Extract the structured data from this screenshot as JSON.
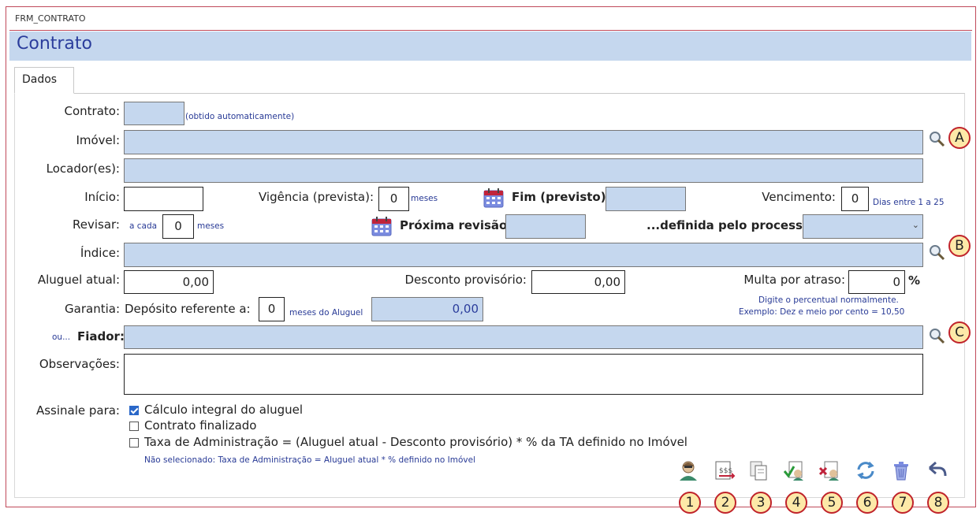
{
  "window": {
    "form_name": "FRM_CONTRATO",
    "title": "Contrato"
  },
  "tabs": [
    {
      "label": "Dados"
    }
  ],
  "fields": {
    "contrato": {
      "label": "Contrato:",
      "value": "",
      "note": "(obtido automaticamente)"
    },
    "imovel": {
      "label": "Imóvel:",
      "value": ""
    },
    "locador": {
      "label": "Locador(es):",
      "value": ""
    },
    "inicio": {
      "label": "Início:",
      "value": ""
    },
    "vigencia": {
      "label": "Vigência (prevista):",
      "value": "0",
      "unit": "meses"
    },
    "fim": {
      "label": "Fim (previsto):",
      "value": ""
    },
    "vencimento": {
      "label": "Vencimento:",
      "value": "0",
      "note": "Dias entre 1 a 25"
    },
    "revisar": {
      "label": "Revisar:",
      "prefix": "a cada",
      "value": "0",
      "unit": "meses"
    },
    "proxima_revisao": {
      "label": "Próxima revisão:",
      "value": ""
    },
    "processo": {
      "label": "...definida pelo processo:",
      "value": ""
    },
    "indice": {
      "label": "Índice:",
      "value": ""
    },
    "aluguel_atual": {
      "label": "Aluguel atual:",
      "value": "0,00"
    },
    "desconto": {
      "label": "Desconto provisório:",
      "value": "0,00"
    },
    "multa": {
      "label": "Multa por atraso:",
      "value": "0",
      "unit": "%",
      "note1": "Digite o percentual normalmente.",
      "note2": "Exemplo: Dez e meio por cento = 10,50"
    },
    "garantia": {
      "label": "Garantia:",
      "deposito_label": "Depósito referente a:",
      "meses_value": "0",
      "meses_unit": "meses do Aluguel",
      "deposito_value": "0,00"
    },
    "fiador": {
      "prefix": "ou...",
      "label": "Fiador:",
      "value": ""
    },
    "observacoes": {
      "label": "Observações:",
      "value": ""
    }
  },
  "assinale": {
    "label": "Assinale para:",
    "options": [
      {
        "label": "Cálculo integral do aluguel",
        "checked": true
      },
      {
        "label": "Contrato finalizado",
        "checked": false
      },
      {
        "label": "Taxa de Administração = (Aluguel atual -  Desconto provisório) * % da TA definido no Imóvel",
        "checked": false
      }
    ],
    "note": "Não selecionado: Taxa de Administração = Aluguel atual * % definido no Imóvel"
  },
  "callouts": {
    "a": "A",
    "b": "B",
    "c": "C"
  },
  "toolbar": {
    "buttons": [
      {
        "num": "1",
        "icon": "person-icon"
      },
      {
        "num": "2",
        "icon": "money-document-icon"
      },
      {
        "num": "3",
        "icon": "copy-icon"
      },
      {
        "num": "4",
        "icon": "approve-icon"
      },
      {
        "num": "5",
        "icon": "reject-icon"
      },
      {
        "num": "6",
        "icon": "refresh-icon"
      },
      {
        "num": "7",
        "icon": "trash-icon"
      },
      {
        "num": "8",
        "icon": "undo-icon"
      }
    ]
  },
  "colors": {
    "accent": "#2b3d9c",
    "field_bg": "#c5d7ee",
    "callout_border": "#c0232b",
    "callout_fill": "#fde9a8"
  }
}
